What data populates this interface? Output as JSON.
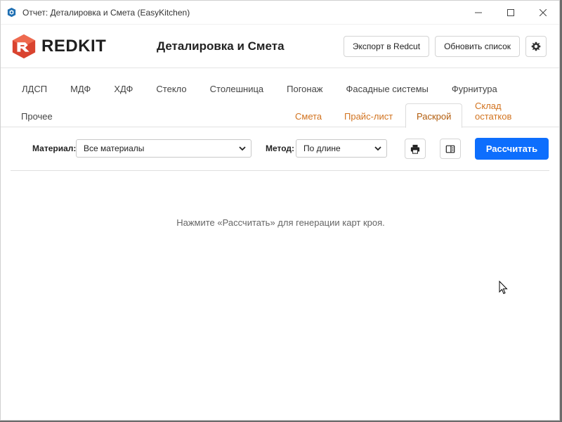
{
  "window": {
    "title": "Отчет: Деталировка и Смета (EasyKitchen)",
    "minimize_icon": "minimize-icon",
    "maximize_icon": "maximize-icon",
    "close_icon": "close-icon"
  },
  "header": {
    "logo_text": "REDKIT",
    "page_title": "Деталировка и Смета",
    "export_label": "Экспорт в Redcut",
    "refresh_label": "Обновить список",
    "settings_icon": "gear-icon"
  },
  "tabs": {
    "row1": [
      "ЛДСП",
      "МДФ",
      "ХДФ",
      "Стекло",
      "Столешница",
      "Погонаж",
      "Фасадные системы",
      "Фурнитура"
    ],
    "row2_left": "Прочее",
    "row2_right": [
      "Смета",
      "Прайс-лист",
      "Раскрой",
      "Склад остатков"
    ],
    "active": "Раскрой"
  },
  "toolbar": {
    "material_label": "Материал:",
    "material_value": "Все материалы",
    "method_label": "Метод:",
    "method_value": "По длине",
    "print_icon": "print-icon",
    "panel_icon": "panel-icon",
    "calculate_label": "Рассчитать"
  },
  "main": {
    "empty_message": "Нажмите «Рассчитать» для генерации карт кроя."
  },
  "colors": {
    "accent_blue": "#0d6efd",
    "tab_orange": "#d2731f",
    "logo_red": "#d9432f"
  }
}
